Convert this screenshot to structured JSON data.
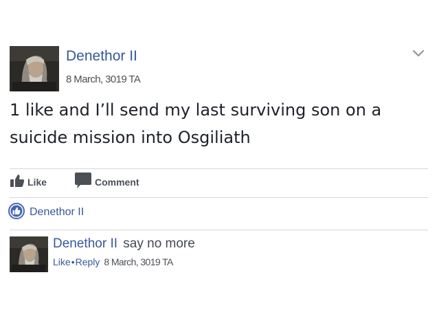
{
  "post": {
    "author": "Denethor II",
    "date": "8 March, 3019 TA",
    "text_lines": [
      "1 like and I’ll send my last surviving son on a",
      "suicide mission into Osgiliath"
    ],
    "menu_icon": "chevron-down-icon"
  },
  "actions": {
    "like_label": "Like",
    "comment_label": "Comment",
    "like_icon": "thumbs-up-icon",
    "comment_icon": "speech-bubble-icon"
  },
  "reactions": {
    "icon": "like-reaction-icon",
    "liker_name": "Denethor II"
  },
  "comment": {
    "author": "Denethor II",
    "text": "say no more",
    "like_label": "Like",
    "separator": "•",
    "reply_label": "Reply",
    "date": "8 March, 3019 TA"
  },
  "colors": {
    "link": "#365899",
    "text": "#1d2129",
    "muted": "#4b4f56",
    "like_blue": "#4267b2",
    "divider": "#d6d7da"
  }
}
